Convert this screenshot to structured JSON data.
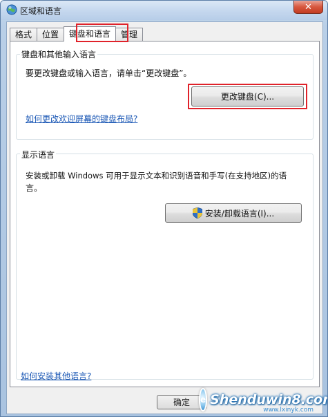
{
  "window": {
    "title": "区域和语言",
    "close_glyph": "✕"
  },
  "tabs": [
    {
      "label": "格式"
    },
    {
      "label": "位置"
    },
    {
      "label": "键盘和语言"
    },
    {
      "label": "管理"
    }
  ],
  "keyboard_group": {
    "label": "键盘和其他输入语言",
    "description": "要更改键盘或输入语言，请单击“更改键盘”。",
    "change_button": "更改键盘(C)...",
    "link": "如何更改欢迎屏幕的键盘布局?"
  },
  "display_group": {
    "label": "显示语言",
    "description_line1": "安装或卸载 Windows 可用于显示文本和识别语音和手写(在支持地区)的语",
    "description_line2": "言。",
    "install_button": "安装/卸载语言(I)..."
  },
  "footer_link": "如何安装其他语言?",
  "ok_button": "确定",
  "watermark": {
    "brand": "Shenduwin8.com",
    "sub": "www.lxinyk.com"
  },
  "colors": {
    "highlight": "#e0222a",
    "link": "#1a57b5",
    "title_bar": "#c4d7ee"
  }
}
